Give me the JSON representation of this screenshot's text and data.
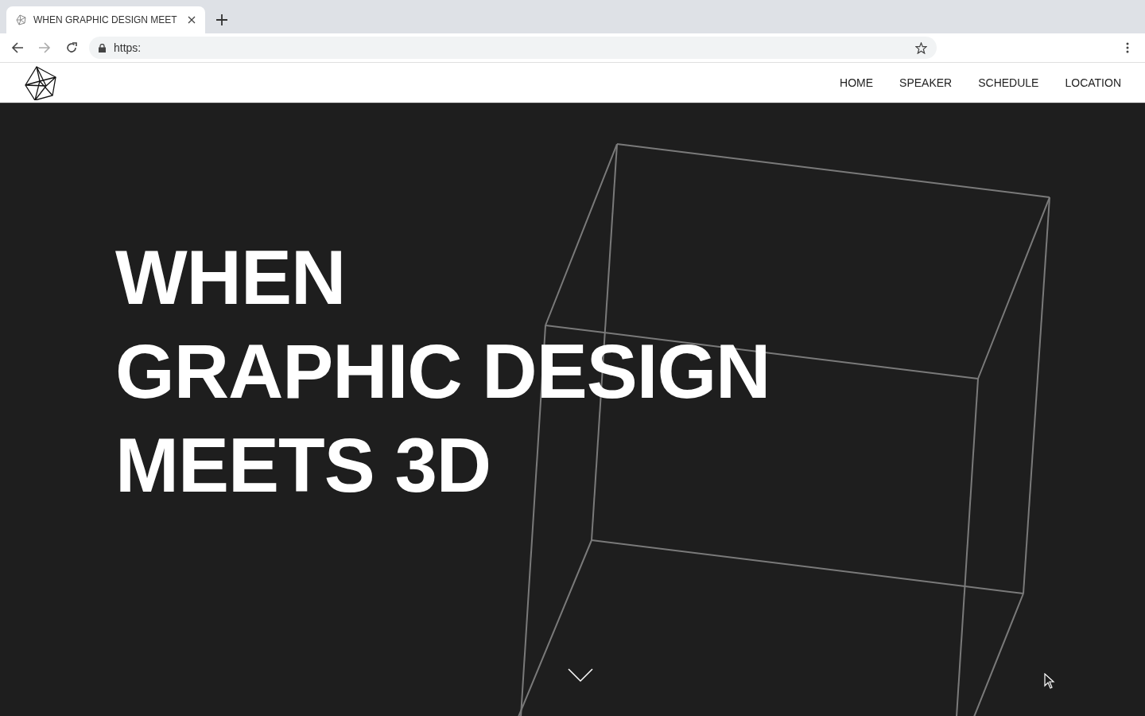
{
  "browser": {
    "tab": {
      "title": "WHEN GRAPHIC DESIGN MEET",
      "selected": true
    },
    "address": "https:"
  },
  "site_header": {
    "nav": [
      {
        "label": "HOME"
      },
      {
        "label": "SPEAKER"
      },
      {
        "label": "SCHEDULE"
      },
      {
        "label": "LOCATION"
      }
    ]
  },
  "hero": {
    "heading_lines": [
      "WHEN",
      "GRAPHIC DESIGN",
      "MEETS 3D"
    ]
  }
}
